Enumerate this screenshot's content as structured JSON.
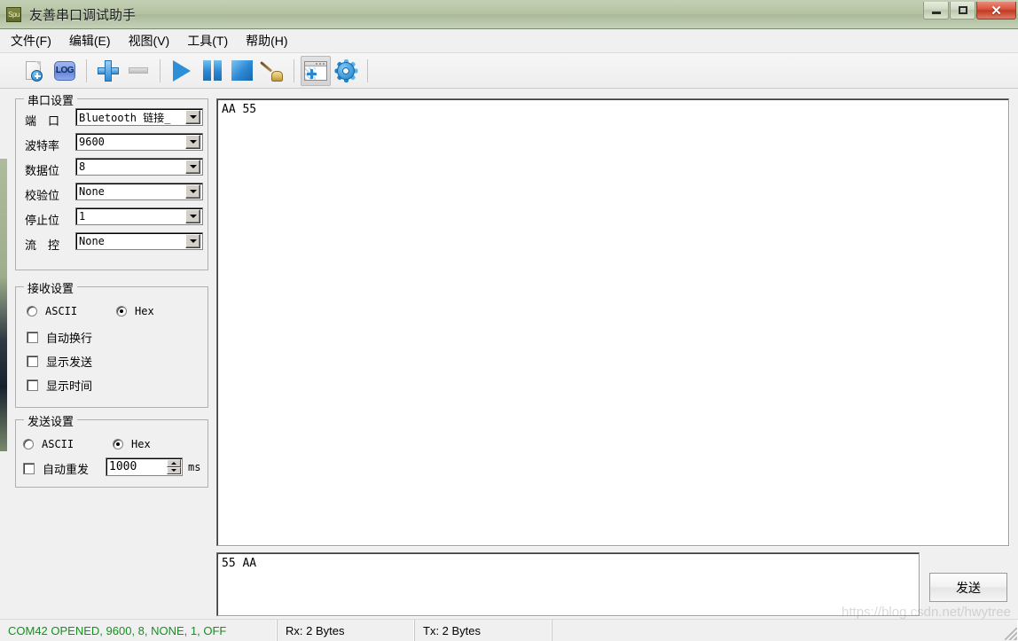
{
  "window": {
    "app_icon_text": "Spu",
    "title": "友善串口调试助手",
    "minimize_label": "最小化",
    "maximize_label": "最大化",
    "close_label": "关闭"
  },
  "menubar": {
    "items": [
      {
        "label": "文件(F)"
      },
      {
        "label": "编辑(E)"
      },
      {
        "label": "视图(V)"
      },
      {
        "label": "工具(T)"
      },
      {
        "label": "帮助(H)"
      }
    ]
  },
  "toolbar": {
    "buttons": [
      {
        "icon": "new-document-icon",
        "label": "新建"
      },
      {
        "icon": "log-icon",
        "label": "LOG"
      },
      {
        "icon": "plus-icon",
        "label": "添加"
      },
      {
        "icon": "minus-icon",
        "label": "移除"
      },
      {
        "icon": "play-icon",
        "label": "打开串口"
      },
      {
        "icon": "pause-icon",
        "label": "暂停"
      },
      {
        "icon": "stop-icon",
        "label": "关闭串口"
      },
      {
        "icon": "broom-icon",
        "label": "清空"
      },
      {
        "icon": "window-add-icon",
        "label": "新窗口"
      },
      {
        "icon": "gear-icon",
        "label": "设置"
      }
    ],
    "log_icon_text": "LOG"
  },
  "serial_settings": {
    "title": "串口设置",
    "fields": [
      {
        "label": "端　口",
        "value": "Bluetooth 链接_"
      },
      {
        "label": "波特率",
        "value": "9600"
      },
      {
        "label": "数据位",
        "value": "8"
      },
      {
        "label": "校验位",
        "value": "None"
      },
      {
        "label": "停止位",
        "value": "1"
      },
      {
        "label": "流　控",
        "value": "None"
      }
    ]
  },
  "receive_settings": {
    "title": "接收设置",
    "radios": [
      {
        "label": "ASCII",
        "checked": false
      },
      {
        "label": "Hex",
        "checked": true
      }
    ],
    "checkboxes": [
      {
        "label": "自动换行",
        "checked": false
      },
      {
        "label": "显示发送",
        "checked": false
      },
      {
        "label": "显示时间",
        "checked": false
      }
    ]
  },
  "send_settings": {
    "title": "发送设置",
    "radios": [
      {
        "label": "ASCII",
        "checked": false
      },
      {
        "label": "Hex",
        "checked": true
      }
    ],
    "auto_resend": {
      "label": "自动重发",
      "checked": false
    },
    "interval_value": "1000",
    "interval_unit": "ms"
  },
  "receive_area": {
    "text": "AA 55"
  },
  "send_area": {
    "text": "55 AA",
    "send_button_label": "发送"
  },
  "history": {
    "value": "55 AA"
  },
  "statusbar": {
    "connection": "COM42 OPENED, 9600, 8, NONE, 1, OFF",
    "rx": "Rx: 2 Bytes",
    "tx": "Tx: 2 Bytes",
    "extra": ""
  },
  "watermark": {
    "text": "https://blog.csdn.net/hwytree"
  },
  "colors": {
    "titlebar": "#b4c3a2",
    "accent_blue": "#2b87d4",
    "status_green": "#159020",
    "close_red": "#d8523c",
    "panel_bg": "#f0f0f0"
  }
}
